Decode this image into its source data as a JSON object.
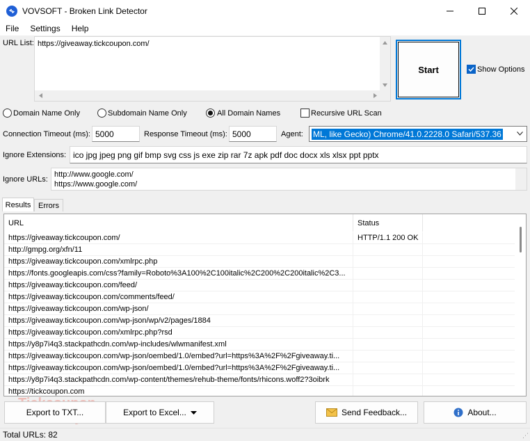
{
  "window": {
    "title": "VOVSOFT - Broken Link Detector",
    "minimize_icon": "minimize-icon",
    "maximize_icon": "maximize-icon",
    "close_icon": "close-icon"
  },
  "menu": [
    "File",
    "Settings",
    "Help"
  ],
  "url_list": {
    "label": "URL List:",
    "value": "https://giveaway.tickcoupon.com/"
  },
  "start_label": "Start",
  "show_options": {
    "label": "Show Options",
    "checked": true
  },
  "scope": {
    "domain_only": "Domain Name Only",
    "subdomain_only": "Subdomain Name Only",
    "all_domains": "All Domain Names",
    "recursive": "Recursive URL Scan",
    "selected": "all_domains"
  },
  "timeouts": {
    "connection_label": "Connection Timeout (ms):",
    "connection_value": "5000",
    "response_label": "Response Timeout (ms):",
    "response_value": "5000",
    "agent_label": "Agent:",
    "agent_value": "ML, like Gecko) Chrome/41.0.2228.0 Safari/537.36"
  },
  "ignore_extensions": {
    "label": "Ignore Extensions:",
    "value": "ico jpg jpeg png gif bmp svg css js exe zip rar 7z apk pdf doc docx xls xlsx ppt pptx"
  },
  "ignore_urls": {
    "label": "Ignore URLs:",
    "line1": "http://www.google.com/",
    "line2": "https://www.google.com/"
  },
  "tabs": {
    "results": "Results",
    "errors": "Errors"
  },
  "results": {
    "col_url": "URL",
    "col_status": "Status",
    "rows": [
      {
        "url": "https://giveaway.tickcoupon.com/",
        "status": "HTTP/1.1 200 OK"
      },
      {
        "url": "http://gmpg.org/xfn/11",
        "status": ""
      },
      {
        "url": "https://giveaway.tickcoupon.com/xmlrpc.php",
        "status": ""
      },
      {
        "url": "https://fonts.googleapis.com/css?family=Roboto%3A100%2C100italic%2C200%2C200italic%2C3...",
        "status": ""
      },
      {
        "url": "https://giveaway.tickcoupon.com/feed/",
        "status": ""
      },
      {
        "url": "https://giveaway.tickcoupon.com/comments/feed/",
        "status": ""
      },
      {
        "url": "https://giveaway.tickcoupon.com/wp-json/",
        "status": ""
      },
      {
        "url": "https://giveaway.tickcoupon.com/wp-json/wp/v2/pages/1884",
        "status": ""
      },
      {
        "url": "https://giveaway.tickcoupon.com/xmlrpc.php?rsd",
        "status": ""
      },
      {
        "url": "https://y8p7i4q3.stackpathcdn.com/wp-includes/wlwmanifest.xml",
        "status": ""
      },
      {
        "url": "https://giveaway.tickcoupon.com/wp-json/oembed/1.0/embed?url=https%3A%2F%2Fgiveaway.ti...",
        "status": ""
      },
      {
        "url": "https://giveaway.tickcoupon.com/wp-json/oembed/1.0/embed?url=https%3A%2F%2Fgiveaway.ti...",
        "status": ""
      },
      {
        "url": "https://y8p7i4q3.stackpathcdn.com/wp-content/themes/rehub-theme/fonts/rhicons.woff2?3oibrk",
        "status": ""
      },
      {
        "url": "https://tickcoupon.com",
        "status": ""
      }
    ]
  },
  "buttons": {
    "export_txt": "Export to TXT...",
    "export_excel": "Export to Excel...",
    "send_feedback": "Send Feedback...",
    "about": "About..."
  },
  "watermark": {
    "line1": "Tickcoupon",
    "line2": "Giveaway"
  },
  "status": {
    "total": "Total URLs: 82"
  },
  "colors": {
    "accent": "#0078d7",
    "selection": "#0078d7"
  }
}
